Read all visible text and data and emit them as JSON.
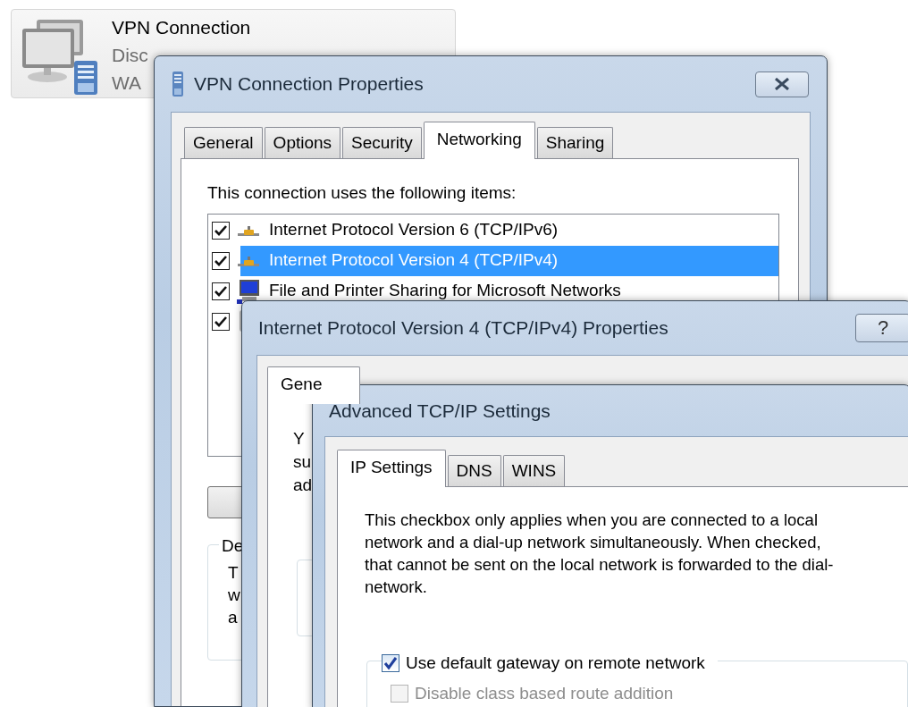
{
  "desktop_item": {
    "title": "VPN Connection",
    "status": "Disc",
    "device": "WA"
  },
  "connection_properties": {
    "title": "VPN Connection Properties",
    "tabs": [
      {
        "label": "General",
        "selected": false
      },
      {
        "label": "Options",
        "selected": false
      },
      {
        "label": "Security",
        "selected": false
      },
      {
        "label": "Networking",
        "selected": true
      },
      {
        "label": "Sharing",
        "selected": false
      }
    ],
    "items_label": "This connection uses the following items:",
    "items": [
      {
        "kind": "protocol",
        "label": "Internet Protocol Version 6 (TCP/IPv6)",
        "checked": true,
        "selected": false
      },
      {
        "kind": "protocol",
        "label": "Internet Protocol Version 4 (TCP/IPv4)",
        "checked": true,
        "selected": true
      },
      {
        "kind": "service",
        "label": "File and Printer Sharing for Microsoft Networks",
        "checked": true,
        "selected": false
      },
      {
        "kind": "client",
        "checked": true,
        "selected": false
      }
    ],
    "description": {
      "label": "De",
      "lines": [
        "T",
        "w",
        "a"
      ]
    }
  },
  "ipv4_properties": {
    "title": "Internet Protocol Version 4 (TCP/IPv4) Properties",
    "help": "?",
    "tabs": [
      {
        "label": "Gene",
        "selected": true
      }
    ],
    "intro_lines": [
      "Y",
      "su",
      "ad"
    ]
  },
  "advanced_settings": {
    "title": "Advanced TCP/IP Settings",
    "tabs": [
      {
        "label": "IP Settings",
        "selected": true
      },
      {
        "label": "DNS",
        "selected": false
      },
      {
        "label": "WINS",
        "selected": false
      }
    ],
    "note_lines": [
      "This checkbox only applies when you are connected to a local",
      "network and a dial-up network simultaneously.  When checked,",
      "that cannot be sent on the local network is forwarded to the dial-",
      "network."
    ],
    "options": [
      {
        "label": "Use default gateway on remote network",
        "checked": true,
        "disabled": false
      },
      {
        "label": "Disable class based route addition",
        "checked": false,
        "disabled": true
      }
    ]
  }
}
